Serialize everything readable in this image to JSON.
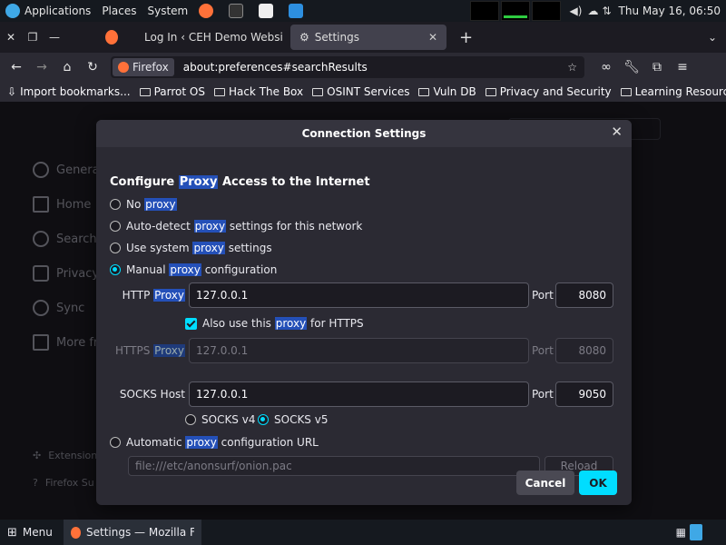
{
  "top_panel": {
    "applications": "Applications",
    "places": "Places",
    "system": "System",
    "clock": "Thu May 16, 06:50"
  },
  "tabs": [
    {
      "label": "",
      "active": false
    },
    {
      "label": "Log In ‹ CEH Demo Websi",
      "active": false
    },
    {
      "label": "Settings",
      "active": true
    }
  ],
  "nav": {
    "identity": "Firefox",
    "url": "about:preferences#searchResults"
  },
  "bookmarks": [
    "Import bookmarks...",
    "Parrot OS",
    "Hack The Box",
    "OSINT Services",
    "Vuln DB",
    "Privacy and Security",
    "Learning Resources"
  ],
  "sidebar": {
    "items": [
      "General",
      "Home",
      "Search",
      "Privacy",
      "Sync",
      "More fro"
    ],
    "bottom": [
      "Extension",
      "Firefox Su"
    ]
  },
  "dialog": {
    "title": "Connection Settings",
    "heading_pre": "Configure ",
    "heading_hl": "Proxy",
    "heading_post": " Access to the Internet",
    "options": {
      "no_proxy_pre": "No ",
      "no_proxy_hl": "proxy",
      "auto_pre": "Auto-detect ",
      "auto_hl": "proxy",
      "auto_post": " settings for this network",
      "system_pre": "Use system ",
      "system_hl": "proxy",
      "system_post": " settings",
      "manual_pre": "Manual ",
      "manual_hl": "proxy",
      "manual_post": " configuration",
      "auto_url_pre": "Automatic ",
      "auto_url_hl": "proxy",
      "auto_url_post": " configuration URL"
    },
    "http_label_pre": "HTTP ",
    "http_label_hl": "Proxy",
    "http_value": "127.0.0.1",
    "http_port": "8080",
    "port_label": "Port",
    "also_https_pre": "Also use this ",
    "also_https_hl": "proxy",
    "also_https_post": " for HTTPS",
    "https_label_pre": "HTTPS ",
    "https_label_hl": "Proxy",
    "https_value": "127.0.0.1",
    "https_port": "8080",
    "socks_label": "SOCKS Host",
    "socks_value": "127.0.0.1",
    "socks_port": "9050",
    "socks_v4": "SOCKS v4",
    "socks_v5": "SOCKS v5",
    "pac_url": "file:///etc/anonsurf/onion.pac",
    "reload": "Reload",
    "cancel": "Cancel",
    "ok": "OK"
  },
  "taskbar": {
    "menu": "Menu",
    "window": "Settings — Mozilla Fir..."
  },
  "colors": {
    "accent": "#00ddff",
    "highlight": "#2450b8",
    "dialog_bg": "#2b2a33"
  }
}
